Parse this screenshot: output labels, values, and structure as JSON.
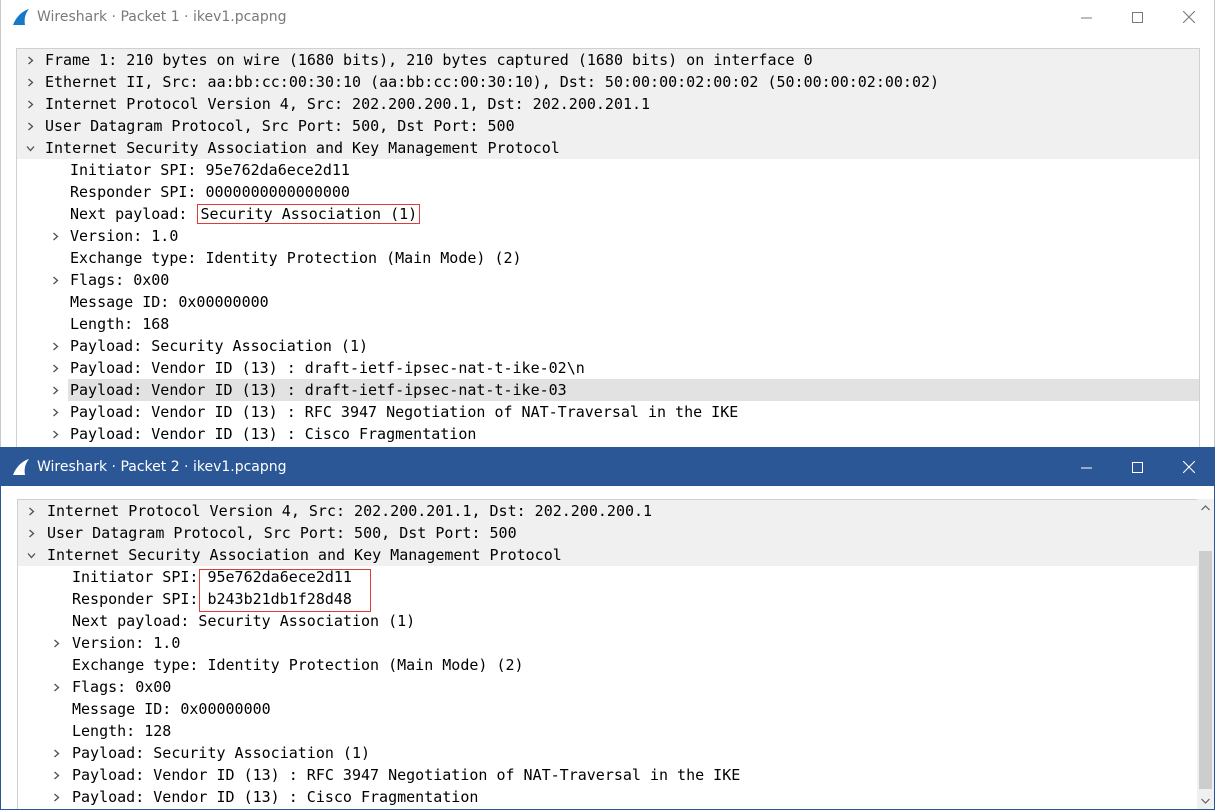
{
  "colors": {
    "active_titlebar": "#2b5797",
    "highlight_box": "#e03a3a",
    "top_level_row": "#f0f0f0",
    "selected_row": "#e2e2e2"
  },
  "window1": {
    "title": "Wireshark · Packet 1 · ikev1.pcapng",
    "rows": [
      {
        "text": "Frame 1: 210 bytes on wire (1680 bits), 210 bytes captured (1680 bits) on interface 0",
        "icon": "chevron-right-icon"
      },
      {
        "text": "Ethernet II, Src: aa:bb:cc:00:30:10 (aa:bb:cc:00:30:10), Dst: 50:00:00:02:00:02 (50:00:00:02:00:02)",
        "icon": "chevron-right-icon"
      },
      {
        "text": "Internet Protocol Version 4, Src: 202.200.200.1, Dst: 202.200.201.1",
        "icon": "chevron-right-icon"
      },
      {
        "text": "User Datagram Protocol, Src Port: 500, Dst Port: 500",
        "icon": "chevron-right-icon"
      },
      {
        "text": "Internet Security Association and Key Management Protocol",
        "icon": "chevron-down-icon"
      },
      {
        "text": "Initiator SPI: 95e762da6ece2d11"
      },
      {
        "text": "Responder SPI: 0000000000000000"
      },
      {
        "prefix": "Next payload: ",
        "value": "Security Association (1)"
      },
      {
        "text": "Version: 1.0",
        "icon": "chevron-right-icon"
      },
      {
        "text": "Exchange type: Identity Protection (Main Mode) (2)"
      },
      {
        "text": "Flags: 0x00",
        "icon": "chevron-right-icon"
      },
      {
        "text": "Message ID: 0x00000000"
      },
      {
        "text": "Length: 168"
      },
      {
        "text": "Payload: Security Association (1)",
        "icon": "chevron-right-icon"
      },
      {
        "text": "Payload: Vendor ID (13) : draft-ietf-ipsec-nat-t-ike-02\\n",
        "icon": "chevron-right-icon"
      },
      {
        "text": "Payload: Vendor ID (13) : draft-ietf-ipsec-nat-t-ike-03",
        "icon": "chevron-right-icon"
      },
      {
        "text": "Payload: Vendor ID (13) : RFC 3947 Negotiation of NAT-Traversal in the IKE",
        "icon": "chevron-right-icon"
      },
      {
        "text": "Payload: Vendor ID (13) : Cisco Fragmentation",
        "icon": "chevron-right-icon"
      }
    ]
  },
  "window2": {
    "title": "Wireshark · Packet 2 · ikev1.pcapng",
    "rows": [
      {
        "text": "Internet Protocol Version 4, Src: 202.200.201.1, Dst: 202.200.200.1",
        "icon": "chevron-right-icon"
      },
      {
        "text": "User Datagram Protocol, Src Port: 500, Dst Port: 500",
        "icon": "chevron-right-icon"
      },
      {
        "text": "Internet Security Association and Key Management Protocol",
        "icon": "chevron-down-icon"
      },
      {
        "prefix": "Initiator SPI: ",
        "value": "95e762da6ece2d11"
      },
      {
        "prefix": "Responder SPI: ",
        "value": "b243b21db1f28d48"
      },
      {
        "text": "Next payload: Security Association (1)"
      },
      {
        "text": "Version: 1.0",
        "icon": "chevron-right-icon"
      },
      {
        "text": "Exchange type: Identity Protection (Main Mode) (2)"
      },
      {
        "text": "Flags: 0x00",
        "icon": "chevron-right-icon"
      },
      {
        "text": "Message ID: 0x00000000"
      },
      {
        "text": "Length: 128"
      },
      {
        "text": "Payload: Security Association (1)",
        "icon": "chevron-right-icon"
      },
      {
        "text": "Payload: Vendor ID (13) : RFC 3947 Negotiation of NAT-Traversal in the IKE",
        "icon": "chevron-right-icon"
      },
      {
        "text": "Payload: Vendor ID (13) : Cisco Fragmentation",
        "icon": "chevron-right-icon"
      }
    ]
  }
}
